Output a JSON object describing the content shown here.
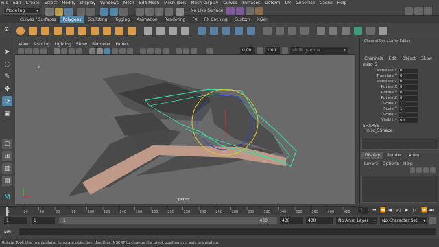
{
  "menubar": {
    "items": [
      "File",
      "Edit",
      "Create",
      "Select",
      "Modify",
      "Display",
      "Windows",
      "Mesh",
      "Edit Mesh",
      "Mesh Tools",
      "Mesh Display",
      "Curves",
      "Surfaces",
      "Deform",
      "UV",
      "Generate",
      "Cache",
      "Help"
    ]
  },
  "statusline": {
    "mode": "Modeling",
    "live_surface": "No Live Surface"
  },
  "shelf": {
    "tabs": [
      "Curves / Surfaces",
      "Polygons",
      "Sculpting",
      "Rigging",
      "Animation",
      "Rendering",
      "FX",
      "FX Caching",
      "Custom",
      "XGen"
    ],
    "active_tab": "Polygons"
  },
  "panel": {
    "menus": [
      "View",
      "Shading",
      "Lighting",
      "Show",
      "Renderer",
      "Panels"
    ],
    "near_clip": "0.00",
    "far_clip": "1.00",
    "color_space": "sRGB gamma",
    "camera_label": "persp"
  },
  "channel_box": {
    "header": "Channel Box / Layer Editor",
    "menus": [
      "Channels",
      "Edit",
      "Object",
      "Show"
    ],
    "object_name": "misc_5",
    "channels": [
      {
        "label": "Translate X",
        "value": "0"
      },
      {
        "label": "Translate Y",
        "value": "0"
      },
      {
        "label": "Translate Z",
        "value": "0"
      },
      {
        "label": "Rotate X",
        "value": "0"
      },
      {
        "label": "Rotate Y",
        "value": "0"
      },
      {
        "label": "Rotate Z",
        "value": "0"
      },
      {
        "label": "Scale X",
        "value": "1"
      },
      {
        "label": "Scale Y",
        "value": "1"
      },
      {
        "label": "Scale Z",
        "value": "1"
      },
      {
        "label": "Visibility",
        "value": "on"
      }
    ],
    "shapes_header": "SHAPES",
    "shape_name": "misc_5Shape"
  },
  "layer_editor": {
    "tabs": [
      "Display",
      "Render",
      "Anim"
    ],
    "active_tab": "Display",
    "menus": [
      "Layers",
      "Options",
      "Help"
    ]
  },
  "timeline": {
    "ticks": [
      "1",
      "20",
      "40",
      "60",
      "80",
      "100",
      "120",
      "140",
      "160",
      "180",
      "200",
      "220",
      "240",
      "260",
      "280",
      "300",
      "320",
      "340",
      "360",
      "380",
      "400",
      "420"
    ],
    "current_frame": "1"
  },
  "range": {
    "start": "1",
    "start_inner": "1",
    "range_start_value": "1",
    "range_end_value": "430",
    "end_inner": "430",
    "end": "430",
    "anim_layer": "No Anim Layer",
    "character_set": "No Character Set"
  },
  "mel": {
    "label": "MEL"
  },
  "help_line": {
    "text": "Rotate Tool: Use manipulator to rotate object(s). Use D or INSERT to change the pivot position and axis orientation."
  },
  "colors": {
    "accent": "#5285a6",
    "selection": "#3cd6a0",
    "viewport_bg": "#6a6a6a"
  }
}
